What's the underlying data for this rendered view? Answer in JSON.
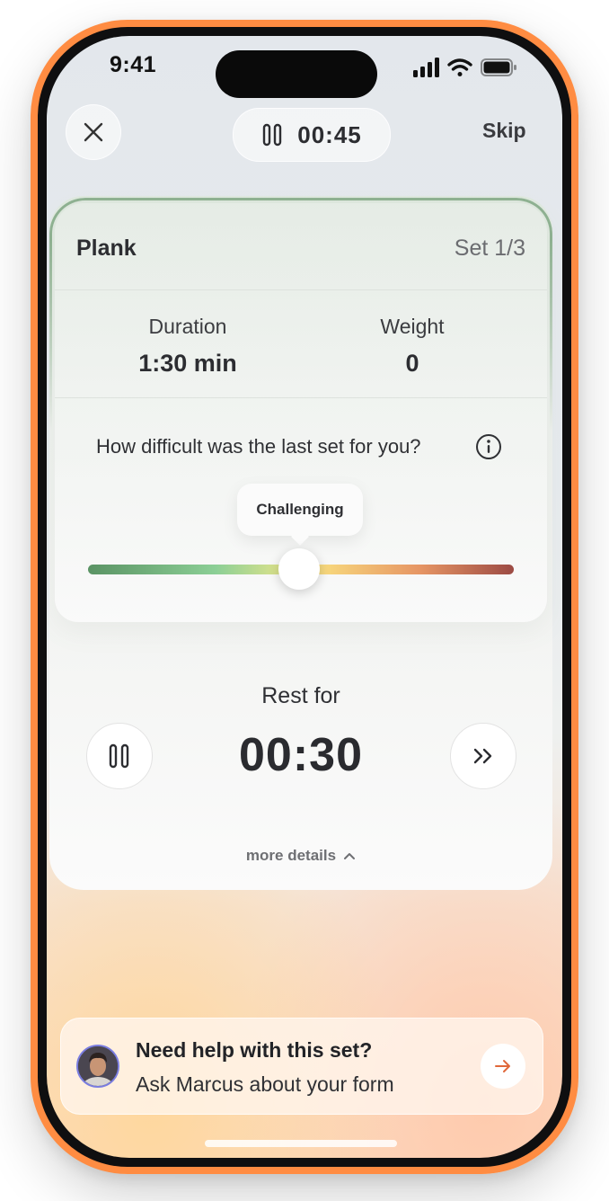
{
  "status_bar": {
    "time": "9:41",
    "icons": [
      "signal-icon",
      "wifi-icon",
      "battery-icon"
    ]
  },
  "header": {
    "close_icon": "close-icon",
    "timer": "00:45",
    "timer_icon": "pause-icon",
    "skip_label": "Skip"
  },
  "exercise": {
    "name": "Plank",
    "set": "Set 1/3",
    "stats": [
      {
        "label": "Duration",
        "value": "1:30 min"
      },
      {
        "label": "Weight",
        "value": "0"
      }
    ],
    "difficulty_question": "How difficult was the last set for you?",
    "difficulty_value": "Challenging",
    "difficulty_level": 0.5
  },
  "rest": {
    "label": "Rest for",
    "time": "00:30",
    "pause_icon": "pause-icon",
    "skip_icon": "fast-forward-icon",
    "more_details": "more details"
  },
  "help": {
    "title": "Need help with this set?",
    "subtitle": "Ask Marcus about your form",
    "arrow_icon": "arrow-right-icon"
  },
  "colors": {
    "frame": "#ff8c42",
    "accent_arrow": "#e0683a",
    "card_border": "#8fb292"
  }
}
